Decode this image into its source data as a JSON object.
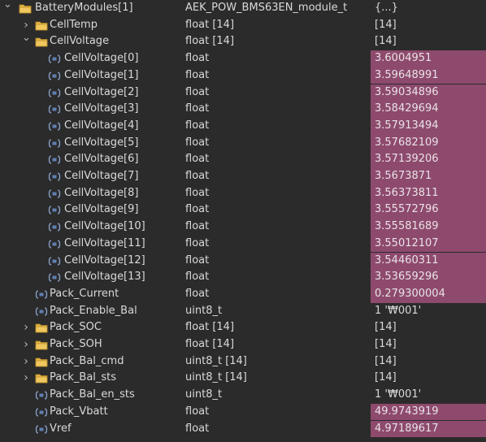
{
  "colors": {
    "background": "#2b2b2b",
    "text": "#d9d9d9",
    "changed_value_highlight": "#8e4a6d",
    "folder_icon": "#e4b54a",
    "variable_icon": "#8da6cf"
  },
  "rows": [
    {
      "level": 0,
      "twisty": "expanded",
      "icon": "folder-icon",
      "name": "BatteryModules[1]",
      "type": "AEK_POW_BMS63EN_module_t",
      "value": "{...}",
      "changed": false
    },
    {
      "level": 1,
      "twisty": "collapsed",
      "icon": "folder-icon",
      "name": "CellTemp",
      "type": "float [14]",
      "value": "[14]",
      "changed": false
    },
    {
      "level": 1,
      "twisty": "expanded",
      "icon": "folder-icon",
      "name": "CellVoltage",
      "type": "float [14]",
      "value": "[14]",
      "changed": false
    },
    {
      "level": 2,
      "twisty": "none",
      "icon": "variable-icon",
      "name": "CellVoltage[0]",
      "type": "float",
      "value": "3.6004951",
      "changed": true
    },
    {
      "level": 2,
      "twisty": "none",
      "icon": "variable-icon",
      "name": "CellVoltage[1]",
      "type": "float",
      "value": "3.59648991",
      "changed": true
    },
    {
      "level": 2,
      "twisty": "none",
      "icon": "variable-icon",
      "name": "CellVoltage[2]",
      "type": "float",
      "value": "3.59034896",
      "changed": true
    },
    {
      "level": 2,
      "twisty": "none",
      "icon": "variable-icon",
      "name": "CellVoltage[3]",
      "type": "float",
      "value": "3.58429694",
      "changed": true
    },
    {
      "level": 2,
      "twisty": "none",
      "icon": "variable-icon",
      "name": "CellVoltage[4]",
      "type": "float",
      "value": "3.57913494",
      "changed": true
    },
    {
      "level": 2,
      "twisty": "none",
      "icon": "variable-icon",
      "name": "CellVoltage[5]",
      "type": "float",
      "value": "3.57682109",
      "changed": true
    },
    {
      "level": 2,
      "twisty": "none",
      "icon": "variable-icon",
      "name": "CellVoltage[6]",
      "type": "float",
      "value": "3.57139206",
      "changed": true
    },
    {
      "level": 2,
      "twisty": "none",
      "icon": "variable-icon",
      "name": "CellVoltage[7]",
      "type": "float",
      "value": "3.5673871",
      "changed": true
    },
    {
      "level": 2,
      "twisty": "none",
      "icon": "variable-icon",
      "name": "CellVoltage[8]",
      "type": "float",
      "value": "3.56373811",
      "changed": true
    },
    {
      "level": 2,
      "twisty": "none",
      "icon": "variable-icon",
      "name": "CellVoltage[9]",
      "type": "float",
      "value": "3.55572796",
      "changed": true
    },
    {
      "level": 2,
      "twisty": "none",
      "icon": "variable-icon",
      "name": "CellVoltage[10]",
      "type": "float",
      "value": "3.55581689",
      "changed": true
    },
    {
      "level": 2,
      "twisty": "none",
      "icon": "variable-icon",
      "name": "CellVoltage[11]",
      "type": "float",
      "value": "3.55012107",
      "changed": true
    },
    {
      "level": 2,
      "twisty": "none",
      "icon": "variable-icon",
      "name": "CellVoltage[12]",
      "type": "float",
      "value": "3.54460311",
      "changed": true
    },
    {
      "level": 2,
      "twisty": "none",
      "icon": "variable-icon",
      "name": "CellVoltage[13]",
      "type": "float",
      "value": "3.53659296",
      "changed": true
    },
    {
      "level": 1,
      "twisty": "none",
      "icon": "variable-icon",
      "name": "Pack_Current",
      "type": "float",
      "value": "0.279300004",
      "changed": true
    },
    {
      "level": 1,
      "twisty": "none",
      "icon": "variable-icon",
      "name": "Pack_Enable_Bal",
      "type": "uint8_t",
      "value": "1 '₩001'",
      "changed": false
    },
    {
      "level": 1,
      "twisty": "collapsed",
      "icon": "folder-icon",
      "name": "Pack_SOC",
      "type": "float [14]",
      "value": "[14]",
      "changed": false
    },
    {
      "level": 1,
      "twisty": "collapsed",
      "icon": "folder-icon",
      "name": "Pack_SOH",
      "type": "float [14]",
      "value": "[14]",
      "changed": false
    },
    {
      "level": 1,
      "twisty": "collapsed",
      "icon": "folder-icon",
      "name": "Pack_Bal_cmd",
      "type": "uint8_t [14]",
      "value": "[14]",
      "changed": false
    },
    {
      "level": 1,
      "twisty": "collapsed",
      "icon": "folder-icon",
      "name": "Pack_Bal_sts",
      "type": "uint8_t [14]",
      "value": "[14]",
      "changed": false
    },
    {
      "level": 1,
      "twisty": "none",
      "icon": "variable-icon",
      "name": "Pack_Bal_en_sts",
      "type": "uint8_t",
      "value": "1 '₩001'",
      "changed": false
    },
    {
      "level": 1,
      "twisty": "none",
      "icon": "variable-icon",
      "name": "Pack_Vbatt",
      "type": "float",
      "value": "49.9743919",
      "changed": true
    },
    {
      "level": 1,
      "twisty": "none",
      "icon": "variable-icon",
      "name": "Vref",
      "type": "float",
      "value": "4.97189617",
      "changed": true
    }
  ]
}
